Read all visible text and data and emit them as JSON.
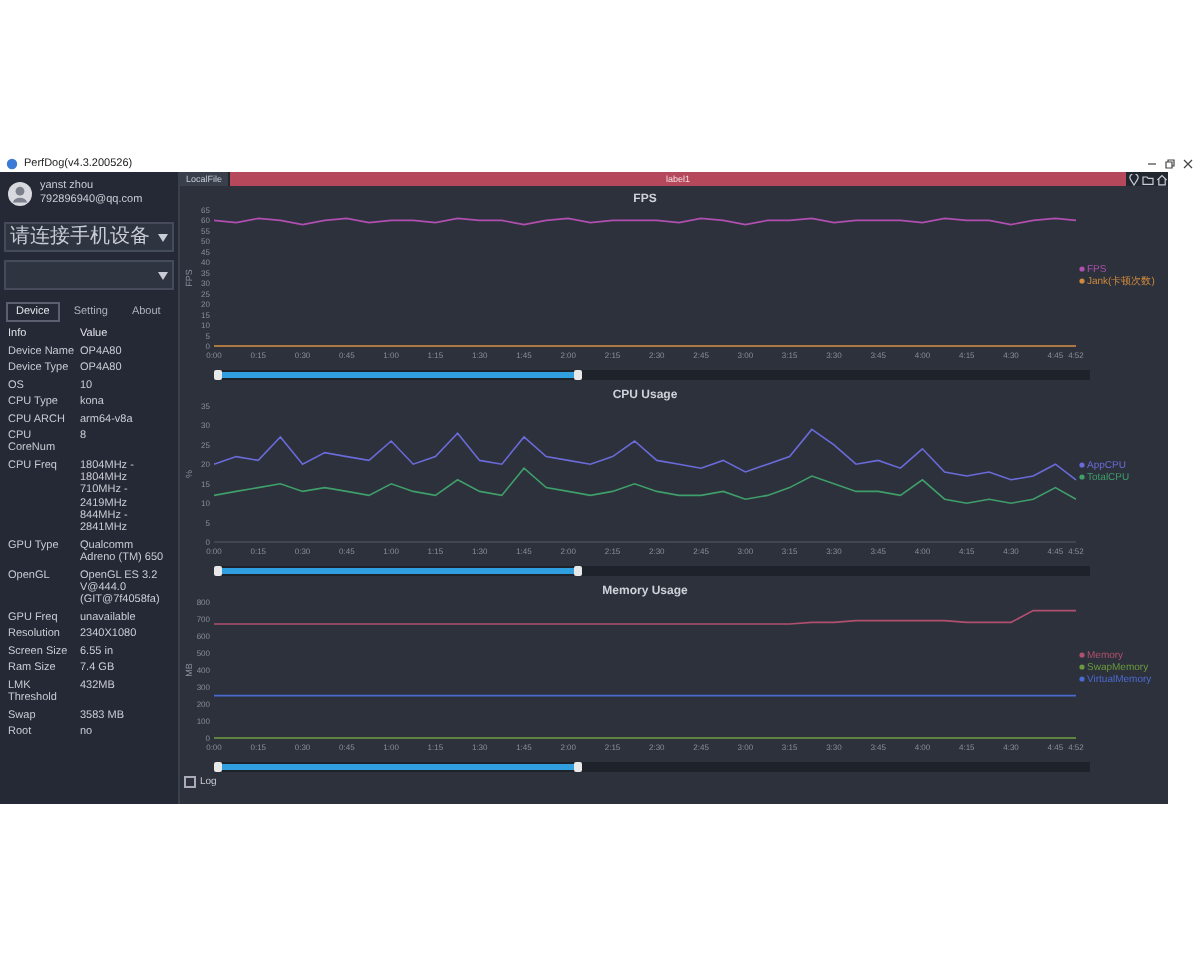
{
  "window": {
    "title": "PerfDog(v4.3.200526)"
  },
  "account": {
    "name": "yanst zhou",
    "email": "792896940@qq.com"
  },
  "device_select": {
    "placeholder": "请连接手机设备"
  },
  "sidebar_tabs": [
    {
      "label": "Device",
      "selected": true
    },
    {
      "label": "Setting",
      "selected": false
    },
    {
      "label": "About",
      "selected": false
    }
  ],
  "device_info": {
    "columns": [
      "Info",
      "Value"
    ],
    "rows": [
      [
        "Device Name",
        "OP4A80"
      ],
      [
        "Device Type",
        "OP4A80"
      ],
      [
        "OS",
        "10"
      ],
      [
        "CPU Type",
        "kona"
      ],
      [
        "CPU ARCH",
        "arm64-v8a"
      ],
      [
        "CPU CoreNum",
        "8"
      ],
      [
        "CPU Freq",
        "1804MHz - 1804MHz\n710MHz - 2419MHz\n844MHz - 2841MHz"
      ],
      [
        "GPU Type",
        "Qualcomm Adreno (TM) 650"
      ],
      [
        "OpenGL",
        "OpenGL ES 3.2 V@444.0 (GIT@7f4058fa)"
      ],
      [
        "GPU Freq",
        "unavailable"
      ],
      [
        "Resolution",
        "2340X1080"
      ],
      [
        "Screen Size",
        "6.55 in"
      ],
      [
        "Ram Size",
        "7.4 GB"
      ],
      [
        "LMK Threshold",
        "432MB"
      ],
      [
        "Swap",
        "3583 MB"
      ],
      [
        "Root",
        "no"
      ]
    ]
  },
  "file_tab": {
    "label": "LocalFile"
  },
  "session_bar": {
    "label": "label1"
  },
  "charts": [
    {
      "slider": {
        "level": 0.42
      },
      "chart_data": {
        "type": "line",
        "title": "FPS",
        "ylabel": "FPS",
        "x": [
          0,
          7.5,
          15,
          22.5,
          30,
          37.5,
          45,
          52.5,
          60,
          67.5,
          75,
          82.5,
          90,
          97.5,
          105,
          112.5,
          120,
          127.5,
          135,
          142.5,
          150,
          157.5,
          165,
          172.5,
          180,
          187.5,
          195,
          202.5,
          210,
          217.5,
          225,
          232.5,
          240,
          247.5,
          255,
          262.5,
          270,
          277.5,
          285,
          292
        ],
        "series": [
          {
            "name": "FPS",
            "color": "#b04fb0",
            "values": [
              60,
              59,
              61,
              60,
              58,
              60,
              61,
              59,
              60,
              60,
              59,
              61,
              60,
              60,
              58,
              60,
              61,
              59,
              60,
              60,
              60,
              59,
              61,
              60,
              58,
              60,
              60,
              61,
              59,
              60,
              60,
              60,
              59,
              61,
              60,
              60,
              58,
              60,
              61,
              60
            ]
          },
          {
            "name": "Jank(卡顿次数)",
            "color": "#d08a3c",
            "values": [
              0,
              0,
              0,
              0,
              0,
              0,
              0,
              0,
              0,
              0,
              0,
              0,
              0,
              0,
              0,
              0,
              0,
              0,
              0,
              0,
              0,
              0,
              0,
              0,
              0,
              0,
              0,
              0,
              0,
              0,
              0,
              0,
              0,
              0,
              0,
              0,
              0,
              0,
              0,
              0
            ]
          }
        ],
        "xlim": [
          0,
          292
        ],
        "ylim": [
          0,
          65
        ],
        "xticks": [
          {
            "value": 0,
            "label": "0:00"
          },
          {
            "value": 15,
            "label": "0:15"
          },
          {
            "value": 30,
            "label": "0:30"
          },
          {
            "value": 45,
            "label": "0:45"
          },
          {
            "value": 60,
            "label": "1:00"
          },
          {
            "value": 75,
            "label": "1:15"
          },
          {
            "value": 90,
            "label": "1:30"
          },
          {
            "value": 105,
            "label": "1:45"
          },
          {
            "value": 120,
            "label": "2:00"
          },
          {
            "value": 135,
            "label": "2:15"
          },
          {
            "value": 150,
            "label": "2:30"
          },
          {
            "value": 165,
            "label": "2:45"
          },
          {
            "value": 180,
            "label": "3:00"
          },
          {
            "value": 195,
            "label": "3:15"
          },
          {
            "value": 210,
            "label": "3:30"
          },
          {
            "value": 225,
            "label": "3:45"
          },
          {
            "value": 240,
            "label": "4:00"
          },
          {
            "value": 255,
            "label": "4:15"
          },
          {
            "value": 270,
            "label": "4:30"
          },
          {
            "value": 285,
            "label": "4:45"
          },
          {
            "value": 292,
            "label": "4:52"
          }
        ],
        "yticks": [
          0,
          5,
          10,
          15,
          20,
          25,
          30,
          35,
          40,
          45,
          50,
          55,
          60,
          65
        ]
      }
    },
    {
      "slider": {
        "level": 0.42
      },
      "chart_data": {
        "type": "line",
        "title": "CPU Usage",
        "ylabel": "%",
        "x": [
          0,
          7.5,
          15,
          22.5,
          30,
          37.5,
          45,
          52.5,
          60,
          67.5,
          75,
          82.5,
          90,
          97.5,
          105,
          112.5,
          120,
          127.5,
          135,
          142.5,
          150,
          157.5,
          165,
          172.5,
          180,
          187.5,
          195,
          202.5,
          210,
          217.5,
          225,
          232.5,
          240,
          247.5,
          255,
          262.5,
          270,
          277.5,
          285,
          292
        ],
        "series": [
          {
            "name": "AppCPU",
            "color": "#6a6ad8",
            "values": [
              20,
              22,
              21,
              27,
              20,
              23,
              22,
              21,
              26,
              20,
              22,
              28,
              21,
              20,
              27,
              22,
              21,
              20,
              22,
              26,
              21,
              20,
              19,
              21,
              18,
              20,
              22,
              29,
              25,
              20,
              21,
              19,
              24,
              18,
              17,
              18,
              16,
              17,
              20,
              16
            ]
          },
          {
            "name": "TotalCPU",
            "color": "#3f9e6a",
            "values": [
              12,
              13,
              14,
              15,
              13,
              14,
              13,
              12,
              15,
              13,
              12,
              16,
              13,
              12,
              19,
              14,
              13,
              12,
              13,
              15,
              13,
              12,
              12,
              13,
              11,
              12,
              14,
              17,
              15,
              13,
              13,
              12,
              16,
              11,
              10,
              11,
              10,
              11,
              14,
              11
            ]
          }
        ],
        "xlim": [
          0,
          292
        ],
        "ylim": [
          0,
          35
        ],
        "xticks": [
          {
            "value": 0,
            "label": "0:00"
          },
          {
            "value": 15,
            "label": "0:15"
          },
          {
            "value": 30,
            "label": "0:30"
          },
          {
            "value": 45,
            "label": "0:45"
          },
          {
            "value": 60,
            "label": "1:00"
          },
          {
            "value": 75,
            "label": "1:15"
          },
          {
            "value": 90,
            "label": "1:30"
          },
          {
            "value": 105,
            "label": "1:45"
          },
          {
            "value": 120,
            "label": "2:00"
          },
          {
            "value": 135,
            "label": "2:15"
          },
          {
            "value": 150,
            "label": "2:30"
          },
          {
            "value": 165,
            "label": "2:45"
          },
          {
            "value": 180,
            "label": "3:00"
          },
          {
            "value": 195,
            "label": "3:15"
          },
          {
            "value": 210,
            "label": "3:30"
          },
          {
            "value": 225,
            "label": "3:45"
          },
          {
            "value": 240,
            "label": "4:00"
          },
          {
            "value": 255,
            "label": "4:15"
          },
          {
            "value": 270,
            "label": "4:30"
          },
          {
            "value": 285,
            "label": "4:45"
          },
          {
            "value": 292,
            "label": "4:52"
          }
        ],
        "yticks": [
          0,
          5,
          10,
          15,
          20,
          25,
          30,
          35
        ]
      }
    },
    {
      "slider": {
        "level": 0.42
      },
      "chart_data": {
        "type": "line",
        "title": "Memory Usage",
        "ylabel": "MB",
        "x": [
          0,
          7.5,
          15,
          22.5,
          30,
          37.5,
          45,
          52.5,
          60,
          67.5,
          75,
          82.5,
          90,
          97.5,
          105,
          112.5,
          120,
          127.5,
          135,
          142.5,
          150,
          157.5,
          165,
          172.5,
          180,
          187.5,
          195,
          202.5,
          210,
          217.5,
          225,
          232.5,
          240,
          247.5,
          255,
          262.5,
          270,
          277.5,
          285,
          292
        ],
        "series": [
          {
            "name": "Memory",
            "color": "#b0506e",
            "values": [
              670,
              670,
              670,
              670,
              670,
              670,
              670,
              670,
              670,
              670,
              670,
              670,
              670,
              670,
              670,
              670,
              670,
              670,
              670,
              670,
              670,
              670,
              670,
              670,
              670,
              670,
              670,
              680,
              680,
              690,
              690,
              690,
              690,
              690,
              680,
              680,
              680,
              750,
              750,
              750
            ]
          },
          {
            "name": "SwapMemory",
            "color": "#6a9a3c",
            "values": [
              0,
              0,
              0,
              0,
              0,
              0,
              0,
              0,
              0,
              0,
              0,
              0,
              0,
              0,
              0,
              0,
              0,
              0,
              0,
              0,
              0,
              0,
              0,
              0,
              0,
              0,
              0,
              0,
              0,
              0,
              0,
              0,
              0,
              0,
              0,
              0,
              0,
              0,
              0,
              0
            ]
          },
          {
            "name": "VirtualMemory",
            "color": "#4a6ad0",
            "values": [
              250,
              250,
              250,
              250,
              250,
              250,
              250,
              250,
              250,
              250,
              250,
              250,
              250,
              250,
              250,
              250,
              250,
              250,
              250,
              250,
              250,
              250,
              250,
              250,
              250,
              250,
              250,
              250,
              250,
              250,
              250,
              250,
              250,
              250,
              250,
              250,
              250,
              250,
              250,
              250
            ]
          }
        ],
        "xlim": [
          0,
          292
        ],
        "ylim": [
          0,
          800
        ],
        "xticks": [
          {
            "value": 0,
            "label": "0:00"
          },
          {
            "value": 15,
            "label": "0:15"
          },
          {
            "value": 30,
            "label": "0:30"
          },
          {
            "value": 45,
            "label": "0:45"
          },
          {
            "value": 60,
            "label": "1:00"
          },
          {
            "value": 75,
            "label": "1:15"
          },
          {
            "value": 90,
            "label": "1:30"
          },
          {
            "value": 105,
            "label": "1:45"
          },
          {
            "value": 120,
            "label": "2:00"
          },
          {
            "value": 135,
            "label": "2:15"
          },
          {
            "value": 150,
            "label": "2:30"
          },
          {
            "value": 165,
            "label": "2:45"
          },
          {
            "value": 180,
            "label": "3:00"
          },
          {
            "value": 195,
            "label": "3:15"
          },
          {
            "value": 210,
            "label": "3:30"
          },
          {
            "value": 225,
            "label": "3:45"
          },
          {
            "value": 240,
            "label": "4:00"
          },
          {
            "value": 255,
            "label": "4:15"
          },
          {
            "value": 270,
            "label": "4:30"
          },
          {
            "value": 285,
            "label": "4:45"
          },
          {
            "value": 292,
            "label": "4:52"
          }
        ],
        "yticks": [
          0,
          100,
          200,
          300,
          400,
          500,
          600,
          700,
          800
        ]
      }
    }
  ],
  "log": {
    "label": "Log",
    "checked": false
  }
}
